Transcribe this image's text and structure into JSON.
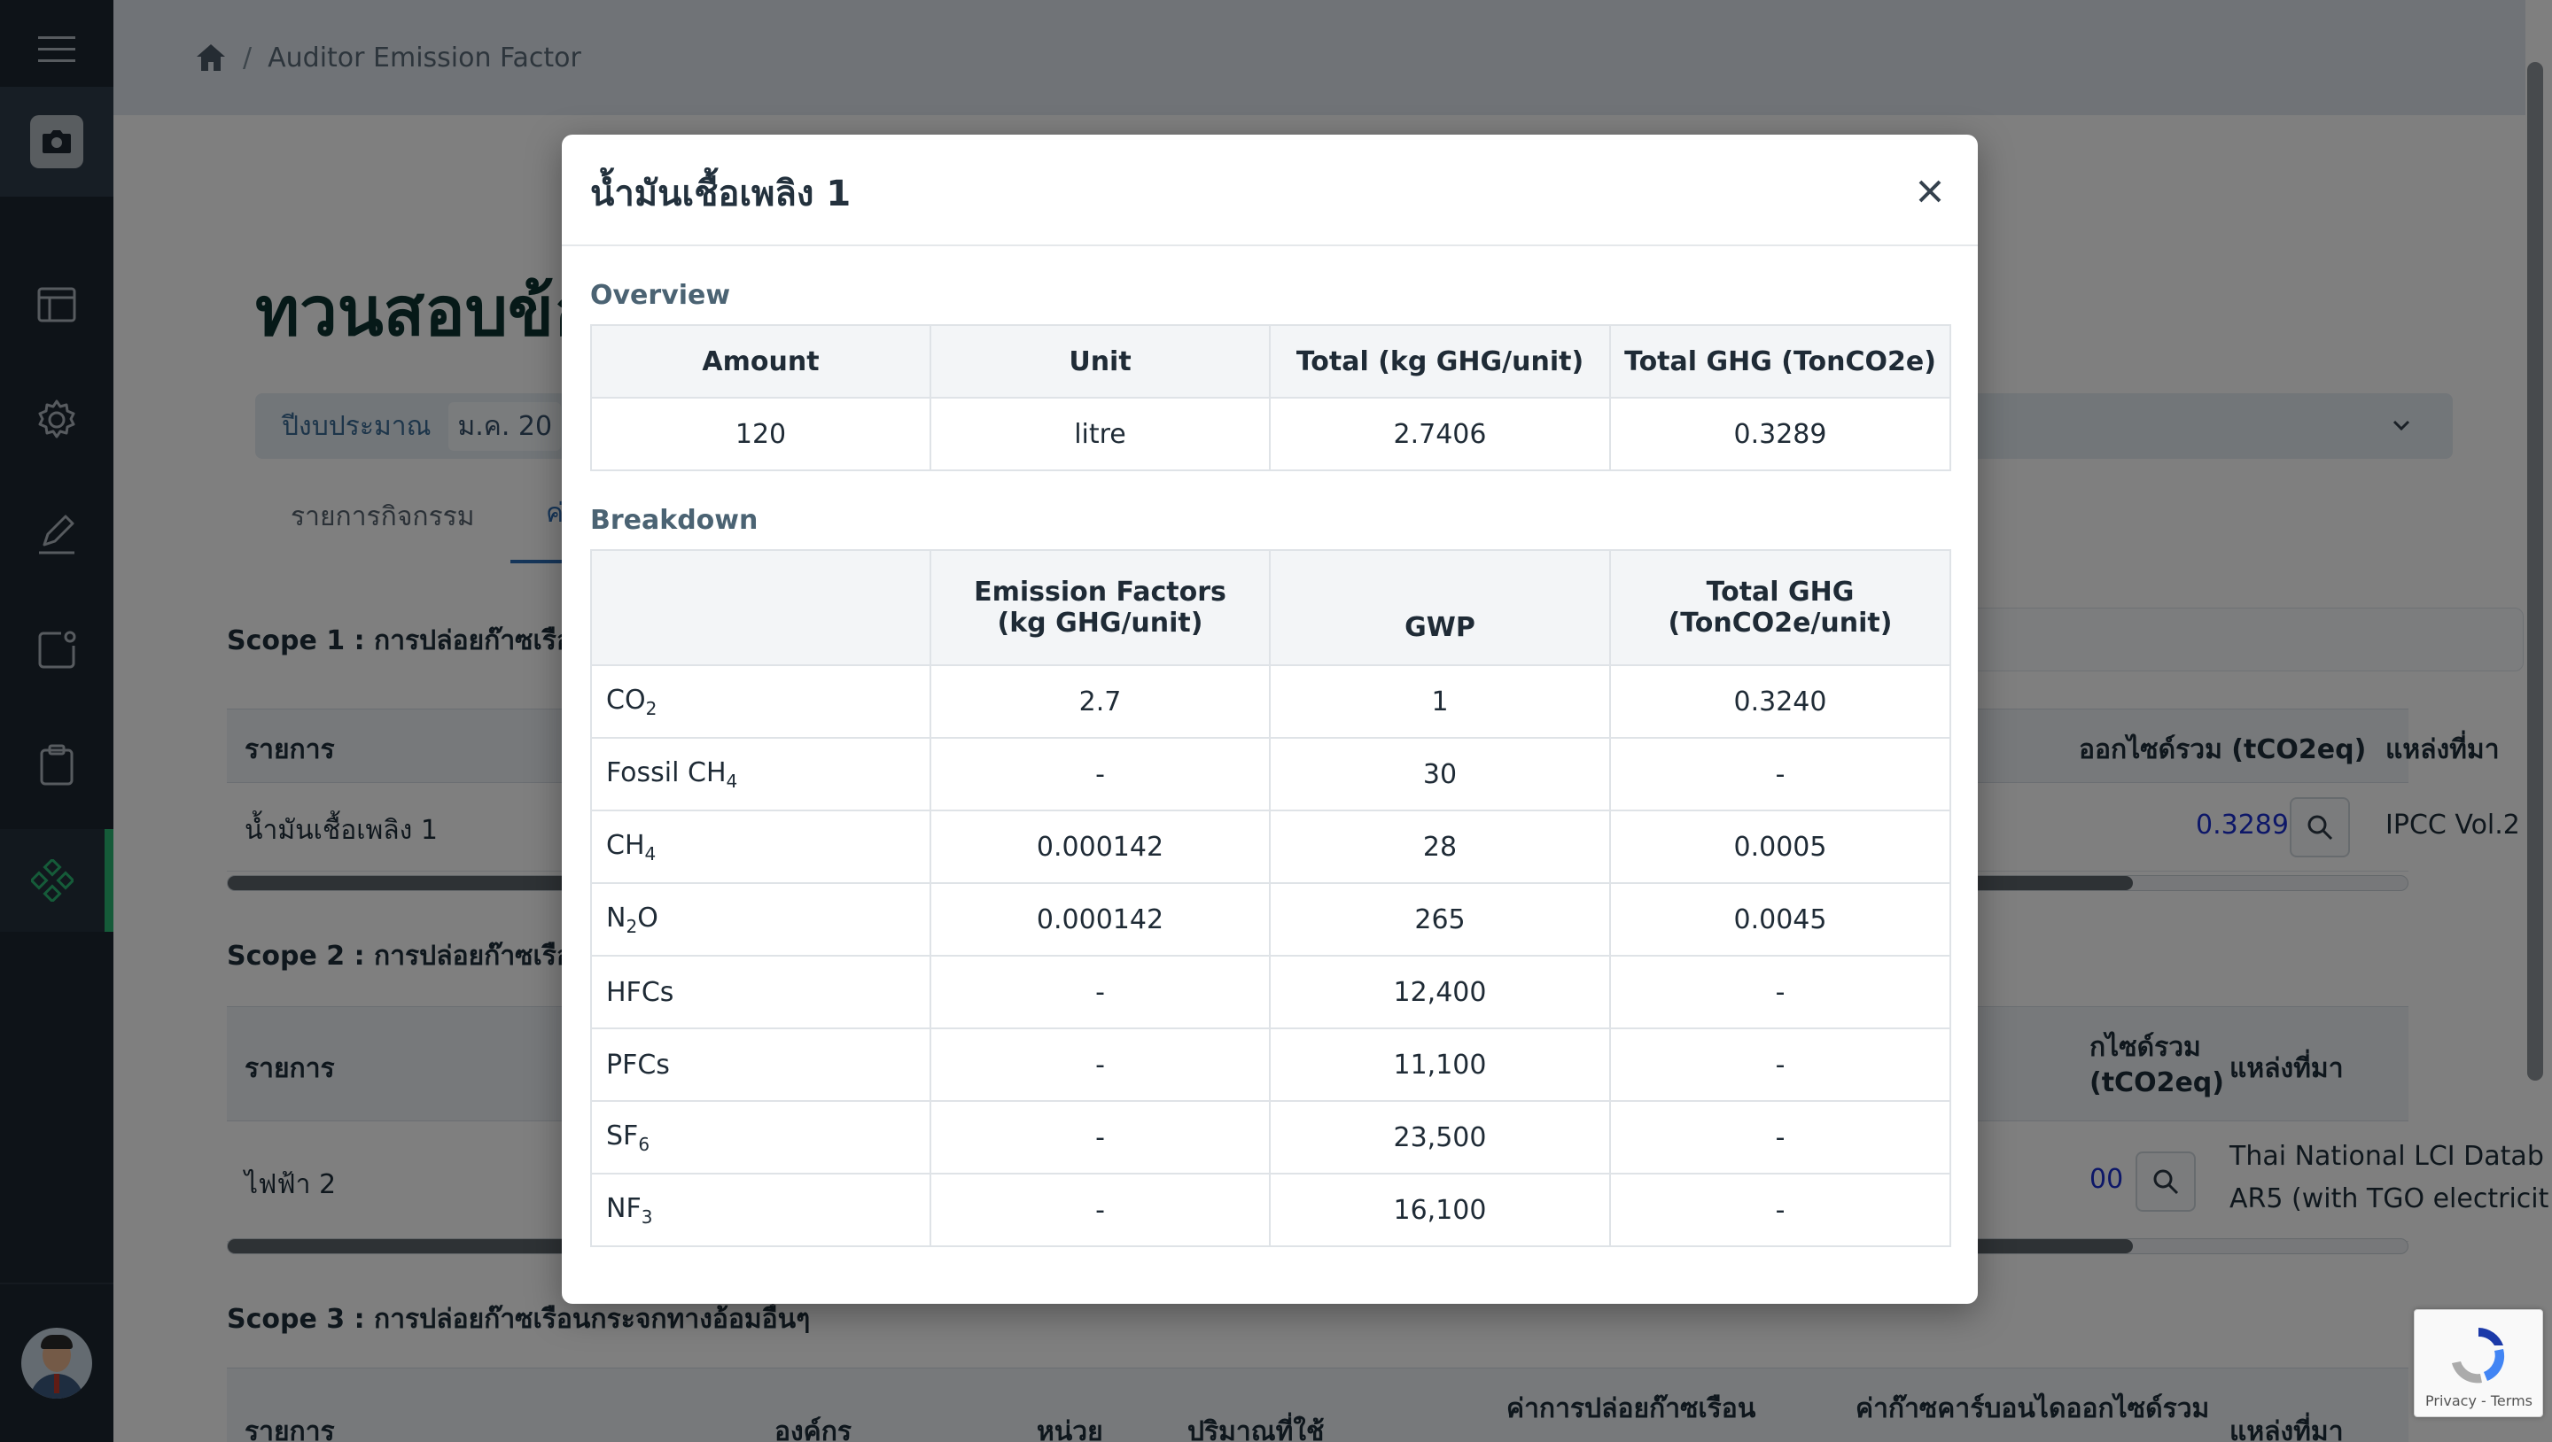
{
  "breadcrumb": {
    "separator": "/",
    "current": "Auditor Emission Factor"
  },
  "page": {
    "title": "ทวนสอบข้อ",
    "budget_label": "ปีงบประมาณ",
    "budget_value": "ม.ค. 20",
    "tabs": [
      "รายการกิจกรรม",
      "ค่"
    ]
  },
  "scope1": {
    "title": "Scope 1 : การปล่อยก๊าซเรือนก",
    "col_item": "รายการ",
    "col_total": "ออกไซด์รวม (tCO2eq)",
    "col_source": "แหล่งที่มา",
    "row_item": "น้ำมันเชื้อเพลิง 1",
    "row_total": "0.3289",
    "row_source": "IPCC Vol.2 t"
  },
  "scope2": {
    "title": "Scope 2 : การปล่อยก๊าซเรือน",
    "col_item": "รายการ",
    "col_total_1": "กไซด์รวม",
    "col_total_2": "(tCO2eq)",
    "col_source": "แหล่งที่มา",
    "row_item": "ไฟฟ้า 2",
    "row_total": "00",
    "row_source_1": "Thai National LCI Datab",
    "row_source_2": "AR5 (with TGO electricit"
  },
  "scope3": {
    "title": "Scope 3 : การปล่อยก๊าซเรือนกระจกทางอ้อมอื่นๆ",
    "cols": [
      "รายการ",
      "องค์กร",
      "หน่วย",
      "ปริมาณที่ใช้",
      "ค่าการปล่อยก๊าซเรือน",
      "ค่าก๊าซคาร์บอนไดออกไซด์รวม",
      "แหล่งที่มา"
    ]
  },
  "modal": {
    "title": "น้ำมันเชื้อเพลิง 1",
    "overview_label": "Overview",
    "overview_headers": [
      "Amount",
      "Unit",
      "Total (kg GHG/unit)",
      "Total GHG (TonCO2e)"
    ],
    "overview_values": [
      "120",
      "litre",
      "2.7406",
      "0.3289"
    ],
    "breakdown_label": "Breakdown",
    "breakdown_headers": [
      "",
      "Emission Factors (kg GHG/unit)",
      "GWP",
      "Total GHG (TonCO2e/unit)"
    ],
    "rows": [
      {
        "gas_prefix": "CO",
        "gas_sub": "2",
        "gas_suffix": "",
        "ef": "2.7",
        "gwp": "1",
        "total": "0.3240"
      },
      {
        "gas_prefix": "Fossil CH",
        "gas_sub": "4",
        "gas_suffix": "",
        "ef": "-",
        "gwp": "30",
        "total": "-"
      },
      {
        "gas_prefix": "CH",
        "gas_sub": "4",
        "gas_suffix": "",
        "ef": "0.000142",
        "gwp": "28",
        "total": "0.0005"
      },
      {
        "gas_prefix": "N",
        "gas_sub": "2",
        "gas_suffix": "O",
        "ef": "0.000142",
        "gwp": "265",
        "total": "0.0045"
      },
      {
        "gas_prefix": "HFCs",
        "gas_sub": "",
        "gas_suffix": "",
        "ef": "-",
        "gwp": "12,400",
        "total": "-"
      },
      {
        "gas_prefix": "PFCs",
        "gas_sub": "",
        "gas_suffix": "",
        "ef": "-",
        "gwp": "11,100",
        "total": "-"
      },
      {
        "gas_prefix": "SF",
        "gas_sub": "6",
        "gas_suffix": "",
        "ef": "-",
        "gwp": "23,500",
        "total": "-"
      },
      {
        "gas_prefix": "NF",
        "gas_sub": "3",
        "gas_suffix": "",
        "ef": "-",
        "gwp": "16,100",
        "total": "-"
      }
    ]
  },
  "recaptcha": {
    "text": "Privacy - Terms"
  },
  "icons": {
    "menu": "hamburger-icon",
    "camera": "camera-icon",
    "layout": "layout-icon",
    "settings": "gear-icon",
    "edit": "edit-icon",
    "export": "export-icon",
    "clipboard": "clipboard-icon",
    "grid": "diamond-grid-icon",
    "home": "home-icon",
    "close": "close-icon",
    "search": "search-icon",
    "chevron": "chevron-down-icon"
  },
  "colors": {
    "sidebar": "#1d2630",
    "accent": "#2bb673",
    "link": "#1a2fd1",
    "title": "#0d3330"
  }
}
